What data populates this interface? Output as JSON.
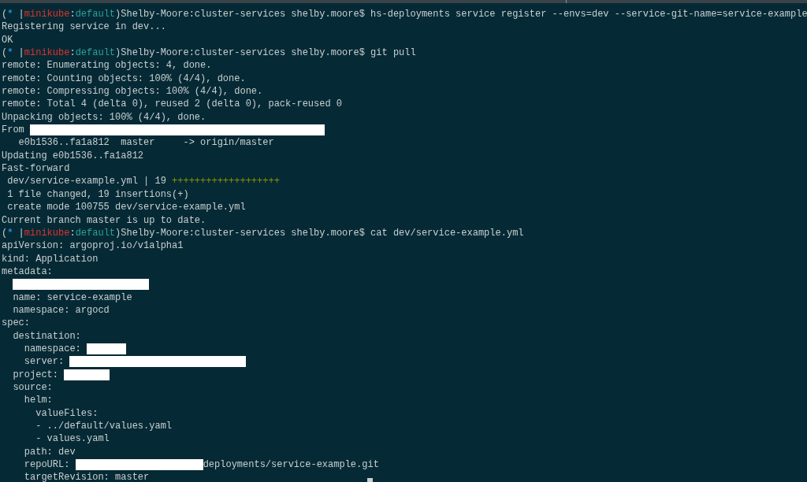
{
  "terminal": {
    "lines": [
      {
        "segments": [
          {
            "text": "("
          },
          {
            "text": "*",
            "color": "#268bd2"
          },
          {
            "text": " |"
          },
          {
            "text": "minikube",
            "color": "#dc322f"
          },
          {
            "text": ":"
          },
          {
            "text": "default",
            "color": "#2aa198"
          },
          {
            "text": ")Shelby-Moore:cluster-services shelby.moore$ hs-deployments service register --envs=dev --service-git-name=service-example"
          }
        ]
      },
      {
        "segments": [
          {
            "text": "Registering service in dev..."
          }
        ]
      },
      {
        "segments": [
          {
            "text": "OK"
          }
        ]
      },
      {
        "segments": [
          {
            "text": "("
          },
          {
            "text": "*",
            "color": "#268bd2"
          },
          {
            "text": " |"
          },
          {
            "text": "minikube",
            "color": "#dc322f"
          },
          {
            "text": ":"
          },
          {
            "text": "default",
            "color": "#2aa198"
          },
          {
            "text": ")Shelby-Moore:cluster-services shelby.moore$ git pull"
          }
        ]
      },
      {
        "segments": [
          {
            "text": "remote: Enumerating objects: 4, done."
          }
        ]
      },
      {
        "segments": [
          {
            "text": "remote: Counting objects: 100% (4/4), done."
          }
        ]
      },
      {
        "segments": [
          {
            "text": "remote: Compressing objects: 100% (4/4), done."
          }
        ]
      },
      {
        "segments": [
          {
            "text": "remote: Total 4 (delta 0), reused 2 (delta 0), pack-reused 0"
          }
        ]
      },
      {
        "segments": [
          {
            "text": "Unpacking objects: 100% (4/4), done."
          }
        ]
      },
      {
        "segments": [
          {
            "text": "From "
          },
          {
            "kind": "redacted"
          }
        ]
      },
      {
        "segments": [
          {
            "text": "   e0b1536..fa1a812  master     -> origin/master"
          }
        ]
      },
      {
        "segments": [
          {
            "text": "Updating e0b1536..fa1a812"
          }
        ]
      },
      {
        "segments": [
          {
            "text": "Fast-forward"
          }
        ]
      },
      {
        "segments": [
          {
            "text": " dev/service-example.yml | 19 "
          },
          {
            "text": "+++++++++++++++++++",
            "color": "#859900"
          }
        ]
      },
      {
        "segments": [
          {
            "text": " 1 file changed, 19 insertions(+)"
          }
        ]
      },
      {
        "segments": [
          {
            "text": " create mode 100755 dev/service-example.yml"
          }
        ]
      },
      {
        "segments": [
          {
            "text": "Current branch master is up to date."
          }
        ]
      },
      {
        "segments": [
          {
            "text": "("
          },
          {
            "text": "*",
            "color": "#268bd2"
          },
          {
            "text": " |"
          },
          {
            "text": "minikube",
            "color": "#dc322f"
          },
          {
            "text": ":"
          },
          {
            "text": "default",
            "color": "#2aa198"
          },
          {
            "text": ")Shelby-Moore:cluster-services shelby.moore$ cat dev/service-example.yml"
          }
        ]
      },
      {
        "segments": [
          {
            "text": "apiVersion: argoproj.io/v1alpha1"
          }
        ]
      },
      {
        "segments": [
          {
            "text": "kind: Application"
          }
        ]
      },
      {
        "segments": [
          {
            "text": "metadata:"
          }
        ]
      },
      {
        "segments": [
          {
            "kind": "redacted"
          }
        ]
      },
      {
        "segments": [
          {
            "text": "  name: service-example"
          }
        ]
      },
      {
        "segments": [
          {
            "text": "  namespace: argocd"
          }
        ]
      },
      {
        "segments": [
          {
            "text": "spec:"
          }
        ]
      },
      {
        "segments": [
          {
            "text": "  destination:"
          }
        ]
      },
      {
        "segments": [
          {
            "text": "    namespace: "
          },
          {
            "kind": "redacted"
          }
        ]
      },
      {
        "segments": [
          {
            "text": "    server: "
          },
          {
            "kind": "redacted"
          }
        ]
      },
      {
        "segments": [
          {
            "text": "  project: "
          },
          {
            "kind": "redacted"
          }
        ]
      },
      {
        "segments": [
          {
            "text": "  source:"
          }
        ]
      },
      {
        "segments": [
          {
            "text": "    helm:"
          }
        ]
      },
      {
        "segments": [
          {
            "text": "      valueFiles:"
          }
        ]
      },
      {
        "segments": [
          {
            "text": "      - ../default/values.yaml"
          }
        ]
      },
      {
        "segments": [
          {
            "text": "      - values.yaml"
          }
        ]
      },
      {
        "segments": [
          {
            "text": "    path: dev"
          }
        ]
      },
      {
        "segments": [
          {
            "text": "    repoURL: "
          },
          {
            "kind": "redacted"
          },
          {
            "text": "deployments/service-example.git"
          }
        ]
      },
      {
        "segments": [
          {
            "text": "    targetRevision: master"
          }
        ]
      }
    ]
  }
}
